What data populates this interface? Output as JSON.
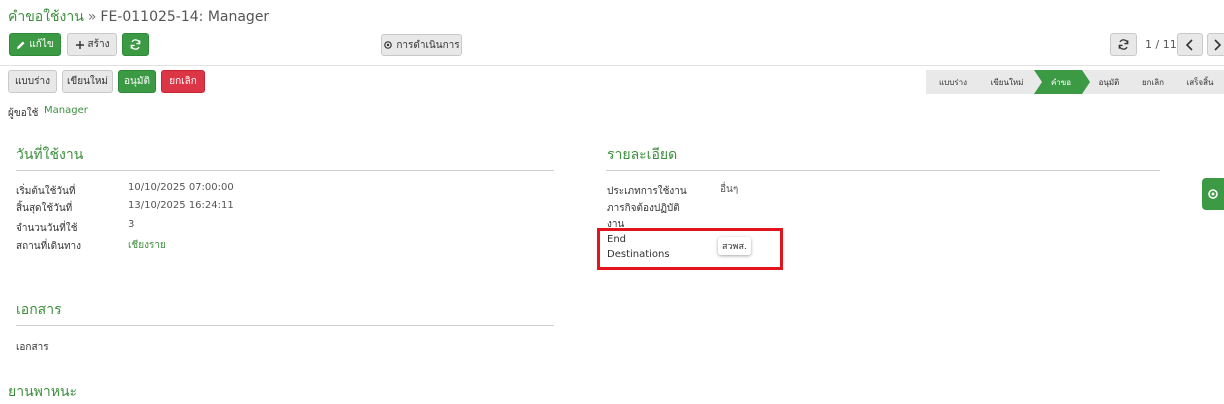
{
  "breadcrumb": {
    "parent": "คำขอใช้งาน",
    "separator": "»",
    "current": "FE-011025-14: Manager"
  },
  "toolbar": {
    "edit_label": "แก้ไข",
    "create_label": "สร้าง",
    "actions_label": "การดำเนินการ",
    "pager": "1 / 11"
  },
  "workflow_buttons": {
    "draft": "แบบร่าง",
    "rewrite": "เขียนใหม่",
    "approve": "อนุมัติ",
    "cancel": "ยกเลิก"
  },
  "status_steps": [
    {
      "label": "แบบร่าง",
      "active": false
    },
    {
      "label": "เขียนใหม่",
      "active": false
    },
    {
      "label": "คำขอ",
      "active": true
    },
    {
      "label": "อนุมัติ",
      "active": false
    },
    {
      "label": "ยกเลิก",
      "active": false
    },
    {
      "label": "เสร็จสิ้น",
      "active": false
    }
  ],
  "requester": {
    "label": "ผู้ขอใช้",
    "value": "Manager"
  },
  "usage_section": {
    "title": "วันที่ใช้งาน",
    "fields": [
      {
        "label": "เริ่มต้นใช้วันที่",
        "value": "10/10/2025 07:00:00"
      },
      {
        "label": "สิ้นสุดใช้วันที่",
        "value": "13/10/2025 16:24:11"
      },
      {
        "label": "จำนวนวันที่ใช้",
        "value": "3"
      },
      {
        "label": "สถานที่เดินทาง",
        "value": "เชียงราย"
      }
    ]
  },
  "details_section": {
    "title": "รายละเอียด",
    "type_label": "ประเภทการใช้งาน",
    "type_value": "อื่นๆ",
    "mission_label_1": "ภารกิจต้องปฏิบัติ",
    "mission_label_2": "งาน",
    "end_label_1": "End",
    "end_label_2": "Destinations",
    "end_value": "สวพส."
  },
  "documents_section": {
    "title": "เอกสาร",
    "field_label": "เอกสาร"
  },
  "vehicle_section": {
    "title": "ยานพาหนะ"
  },
  "colors": {
    "accent": "#3c9a44",
    "danger": "#dc3545",
    "highlight": "#e3141b"
  }
}
